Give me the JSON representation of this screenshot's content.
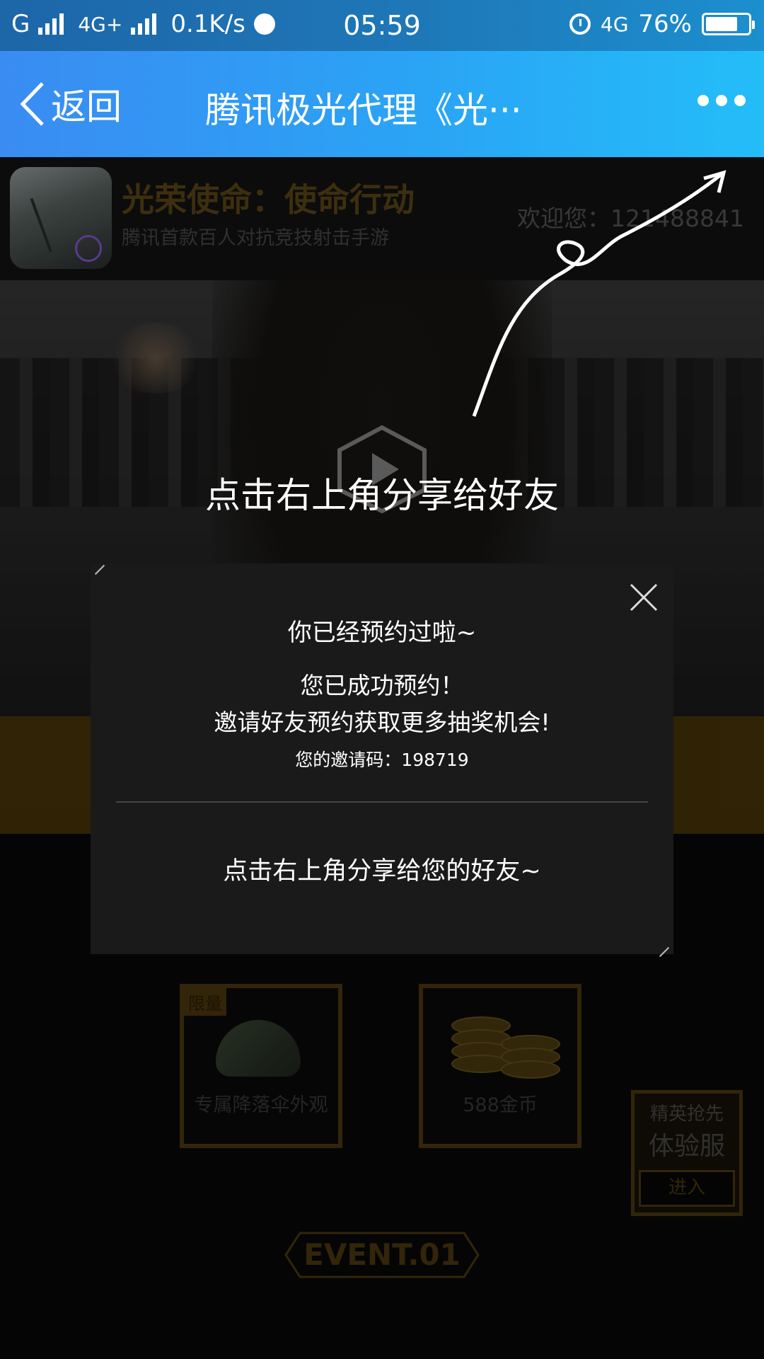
{
  "status_bar": {
    "carrier1": "G",
    "carrier2": "4G+",
    "speed": "0.1K/s",
    "time": "05:59",
    "network_right": "4G",
    "battery": "76%",
    "battery_level": 0.76
  },
  "nav": {
    "back_label": "返回",
    "title": "腾讯极光代理《光···",
    "more_icon": "more-dots-icon"
  },
  "game": {
    "name": "光荣使命：使命行动",
    "subtitle": "腾讯首款百人对抗竞技射击手游",
    "welcome": "欢迎您：121488841"
  },
  "banner": {
    "share_hint": "点击右上角分享给好友"
  },
  "modal": {
    "title": "你已经预约过啦~",
    "line1": "您已成功预约！",
    "line2": "邀请好友预约获取更多抽奖机会!",
    "invite_code": "您的邀请码：198719",
    "share_text": "点击右上角分享给您的好友~"
  },
  "rewards": [
    {
      "tag": "限量",
      "label": "专属降落伞外观"
    },
    {
      "label": "588金币"
    }
  ],
  "elite": {
    "line1": "精英抢先",
    "line2": "体验服",
    "button": "进入"
  },
  "event": {
    "label": "EVENT.01"
  },
  "colors": {
    "titlebar_start": "#3a8cf2",
    "titlebar_end": "#24bdf8",
    "gold": "#4e3a0e"
  }
}
